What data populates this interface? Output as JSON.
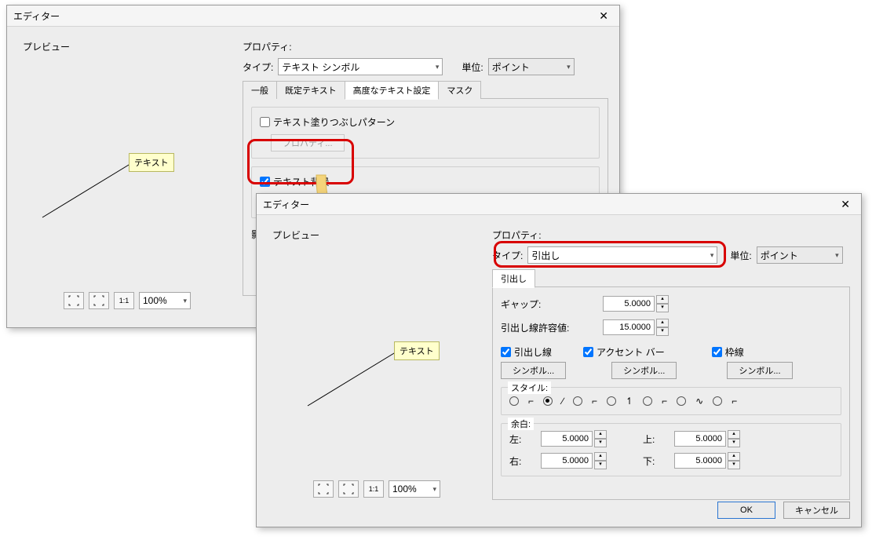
{
  "dlg1": {
    "title": "エディター",
    "preview_label": "プレビュー",
    "text_sample": "テキスト",
    "zoom_value": "100%",
    "prop_label": "プロパティ:",
    "type_label": "タイプ:",
    "type_value": "テキスト シンボル",
    "unit_label": "単位:",
    "unit_value": "ポイント",
    "tabs": {
      "general": "一般",
      "defTxt": "既定テキスト",
      "advTxt": "高度なテキスト設定",
      "mask": "マスク"
    },
    "fillPattern_label": "テキスト塗りつぶしパターン",
    "textBg_label": "テキスト背景",
    "prop_btn": "プロパティ...",
    "shadow_label": "影"
  },
  "dlg2": {
    "title": "エディター",
    "preview_label": "プレビュー",
    "text_sample": "テキスト",
    "zoom_value": "100%",
    "prop_label": "プロパティ:",
    "type_label": "タイプ:",
    "type_value": "引出し",
    "unit_label": "単位:",
    "unit_value": "ポイント",
    "tab_callout": "引出し",
    "gap_label": "ギャップ:",
    "gap_value": "5.0000",
    "tolerance_label": "引出し線許容値:",
    "tolerance_value": "15.0000",
    "leader_label": "引出し線",
    "accent_label": "アクセント バー",
    "border_label": "枠線",
    "symbol_btn": "シンボル...",
    "style_label": "スタイル:",
    "margins_label": "余白:",
    "left_label": "左:",
    "right_label": "右:",
    "top_label": "上:",
    "bottom_label": "下:",
    "margin_value": "5.0000",
    "ok": "OK",
    "cancel": "キャンセル"
  }
}
